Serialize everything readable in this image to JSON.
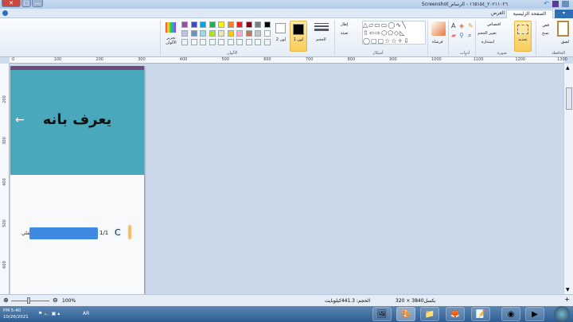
{
  "window": {
    "title": "Screenshot_٢٠٢١١٠٢٦_١٦٥١٥٤ - الرسام",
    "close": "✕",
    "restore": "▢",
    "minimize": "—"
  },
  "tabs": {
    "home": "الصفحة الرئيسية",
    "view": "العرض",
    "file_menu": "▾"
  },
  "ribbon": {
    "clipboard": {
      "group": "الحافظة",
      "paste": "لصق",
      "cut": "قص",
      "copy": "نسخ"
    },
    "image": {
      "group": "صورة",
      "select": "تحديد",
      "crop": "اقتصاص",
      "resize": "تغيير الحجم",
      "rotate": "استدارة"
    },
    "tools": {
      "group": "أدوات"
    },
    "brushes": {
      "label": "فرشاة"
    },
    "shapes": {
      "group": "أشكال",
      "outline": "إطار",
      "fill": "تعبئة"
    },
    "size": {
      "label": "الحجم"
    },
    "color1": {
      "label": "لون 1",
      "value": "#000000"
    },
    "color2": {
      "label": "لون 2",
      "value": "#ffffff"
    },
    "colors": {
      "group": "الألوان",
      "edit": "تحرير الألوان",
      "row1": [
        "#000000",
        "#7f7f7f",
        "#880015",
        "#ed1c24",
        "#ff7f27",
        "#fff200",
        "#22b14c",
        "#00a2e8",
        "#3f48cc",
        "#a349a4"
      ],
      "row2": [
        "#ffffff",
        "#c3c3c3",
        "#b97a57",
        "#ffaec9",
        "#ffc90e",
        "#efe4b0",
        "#b5e61d",
        "#99d9ea",
        "#7092be",
        "#c8bfe7"
      ]
    }
  },
  "ruler": {
    "top": [
      "0",
      "100",
      "200",
      "300",
      "400",
      "500",
      "600",
      "700",
      "800",
      "900",
      "1000",
      "1100",
      "1200",
      "1300"
    ],
    "left": [
      "200",
      "300",
      "400",
      "500",
      "600"
    ]
  },
  "canvas": {
    "heading": "يعرف بانه",
    "counter": "1/1",
    "progress_label": "السفلي",
    "progress": 1.0,
    "teal": "#4aa8bd",
    "purple": "#6b4a7a",
    "bar": "#3f8ae0"
  },
  "status": {
    "size": "الحجم: 441.3كيلوبايت",
    "dimensions": "320 × 3840بكسل",
    "zoom": "100%"
  },
  "taskbar": {
    "time": "PM 5:40",
    "date": "10/26/2021",
    "lang": "AR"
  }
}
